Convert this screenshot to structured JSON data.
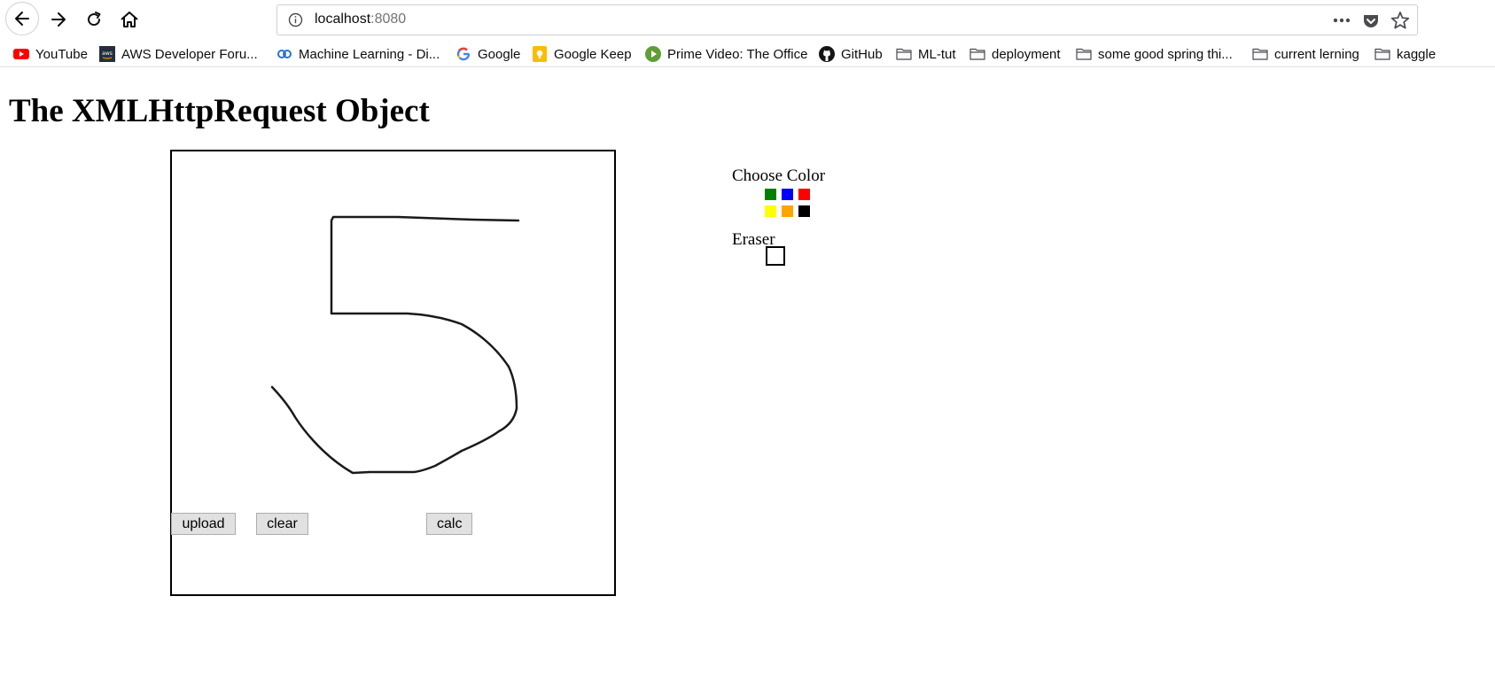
{
  "browser": {
    "url_host": "localhost",
    "url_port": ":8080",
    "icons": {
      "back": "back-arrow-icon",
      "forward": "forward-arrow-icon",
      "reload": "reload-icon",
      "home": "home-icon",
      "info": "info-icon",
      "more": "more-dots-icon",
      "pocket": "pocket-icon",
      "star": "star-icon"
    }
  },
  "bookmarks": [
    {
      "label": "YouTube",
      "icon": "youtube-icon"
    },
    {
      "label": "AWS Developer Foru...",
      "icon": "aws-icon"
    },
    {
      "label": "Machine Learning - Di...",
      "icon": "coursera-icon"
    },
    {
      "label": "Google",
      "icon": "google-icon"
    },
    {
      "label": "Google Keep",
      "icon": "google-keep-icon"
    },
    {
      "label": "Prime Video: The Office",
      "icon": "prime-video-icon"
    },
    {
      "label": "GitHub",
      "icon": "github-icon"
    },
    {
      "label": "ML-tut",
      "icon": "folder-icon"
    },
    {
      "label": "deployment",
      "icon": "folder-icon"
    },
    {
      "label": "some good spring thi...",
      "icon": "folder-icon"
    },
    {
      "label": "current lerning",
      "icon": "folder-icon"
    },
    {
      "label": "kaggle",
      "icon": "folder-icon"
    }
  ],
  "page": {
    "title": "The XMLHttpRequest Object",
    "buttons": {
      "upload": "upload",
      "clear": "clear",
      "calc": "calc"
    },
    "choose_color_label": "Choose Color",
    "eraser_label": "Eraser",
    "colors": [
      "green",
      "blue",
      "red",
      "yellow",
      "orange",
      "black"
    ]
  }
}
